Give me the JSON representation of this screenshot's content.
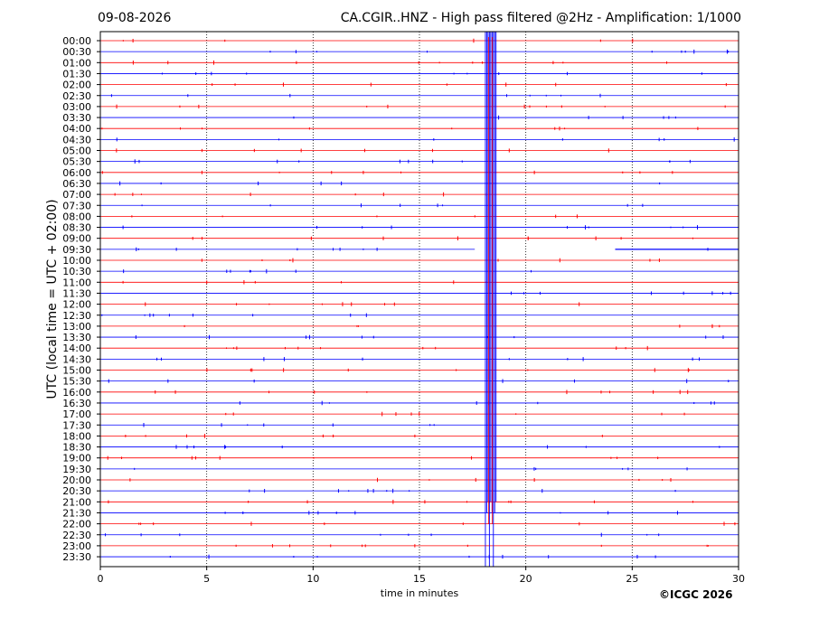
{
  "date": "09-08-2026",
  "title": "CA.CGIR..HNZ - High pass filtered @2Hz - Amplification: 1/1000",
  "copyright": "©ICGC 2026",
  "colors": {
    "trace_a": "#0000ff",
    "trace_b": "#ff0000",
    "axes": "#000000",
    "grid": "#000000"
  },
  "chart_data": {
    "type": "line",
    "title": "CA.CGIR..HNZ - High pass filtered @2Hz - Amplification: 1/1000",
    "xlabel": "time in minutes",
    "ylabel": "UTC (local time = UTC + 02:00)",
    "xlim": [
      0,
      30
    ],
    "x_ticks": [
      0,
      5,
      10,
      15,
      20,
      25,
      30
    ],
    "grid": "vertical dotted",
    "row_labels": [
      "00:00",
      "00:30",
      "01:00",
      "01:30",
      "02:00",
      "02:30",
      "03:00",
      "03:30",
      "04:00",
      "04:30",
      "05:00",
      "05:30",
      "06:00",
      "06:30",
      "07:00",
      "07:30",
      "08:00",
      "08:30",
      "09:00",
      "09:30",
      "10:00",
      "10:30",
      "11:00",
      "11:30",
      "12:00",
      "12:30",
      "13:00",
      "13:30",
      "14:00",
      "14:30",
      "15:00",
      "15:30",
      "16:00",
      "16:30",
      "17:00",
      "17:30",
      "18:00",
      "18:30",
      "19:00",
      "19:30",
      "20:00",
      "20:30",
      "21:00",
      "21:30",
      "22:00",
      "22:30",
      "23:00",
      "23:30"
    ],
    "gap": {
      "row": "09:30",
      "x_start": 17.6,
      "x_end": 24.2
    },
    "event": {
      "x_start": 18.1,
      "x_end": 18.6
    }
  }
}
